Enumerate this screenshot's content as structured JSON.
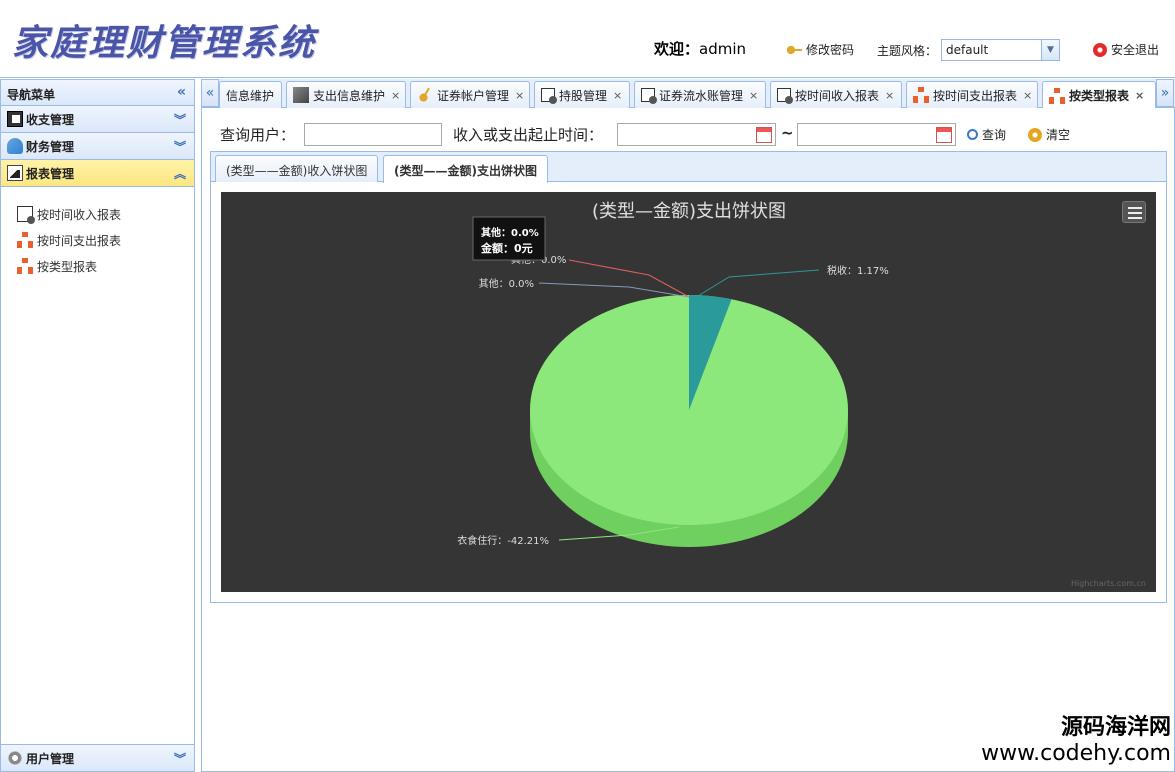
{
  "app": {
    "logo_text": "家庭理财管理系统",
    "welcome_prefix": "欢迎：",
    "username": "admin",
    "change_password": "修改密码",
    "theme_label": "主题风格：",
    "theme_value": "default",
    "logout": "安全退出"
  },
  "sidebar": {
    "title": "导航菜单",
    "panels": [
      {
        "label": "收支管理"
      },
      {
        "label": "财务管理"
      },
      {
        "label": "报表管理"
      }
    ],
    "report_items": [
      {
        "label": "按时间收入报表"
      },
      {
        "label": "按时间支出报表"
      },
      {
        "label": "按类型报表"
      }
    ],
    "user_panel": "用户管理"
  },
  "tabs": [
    {
      "label": "信息维护"
    },
    {
      "label": "支出信息维护"
    },
    {
      "label": "证券帐户管理"
    },
    {
      "label": "持股管理"
    },
    {
      "label": "证券流水账管理"
    },
    {
      "label": "按时间收入报表"
    },
    {
      "label": "按时间支出报表"
    },
    {
      "label": "按类型报表"
    }
  ],
  "query": {
    "user_label": "查询用户：",
    "range_label": "收入或支出起止时间：",
    "tilde": "~",
    "search": "查询",
    "clear": "清空",
    "user_value": "",
    "start_value": "",
    "end_value": ""
  },
  "inner_tabs": [
    {
      "label": "(类型——金额)收入饼状图"
    },
    {
      "label": "(类型——金额)支出饼状图"
    }
  ],
  "chart_data": {
    "type": "pie",
    "title": "(类型—金额)支出饼状图",
    "slices": [
      {
        "name": "衣食住行",
        "percent": -42.21,
        "label": "衣食住行：-42.21%",
        "color": "#8ce87a"
      },
      {
        "name": "税收",
        "percent": 1.17,
        "label": "税收：1.17%",
        "color": "#2a9a9a"
      },
      {
        "name": "其他",
        "percent": 0.0,
        "label": "其他：0.0%",
        "color": "#8899bb"
      },
      {
        "name": "其他",
        "percent": 0.0,
        "label": "其他：0.0%",
        "color": "#e06060"
      }
    ],
    "tooltip": {
      "line1": "其他：0.0%",
      "line2_label": "金额：",
      "line2_value": "0元"
    },
    "credit": "Highcharts.com.cn"
  },
  "watermark": {
    "line1": "源码海洋网",
    "line2": "www.codehy.com"
  },
  "colors": {
    "border": "#99bbe8",
    "chart_bg": "#353535",
    "logo": "#4a55a8"
  }
}
